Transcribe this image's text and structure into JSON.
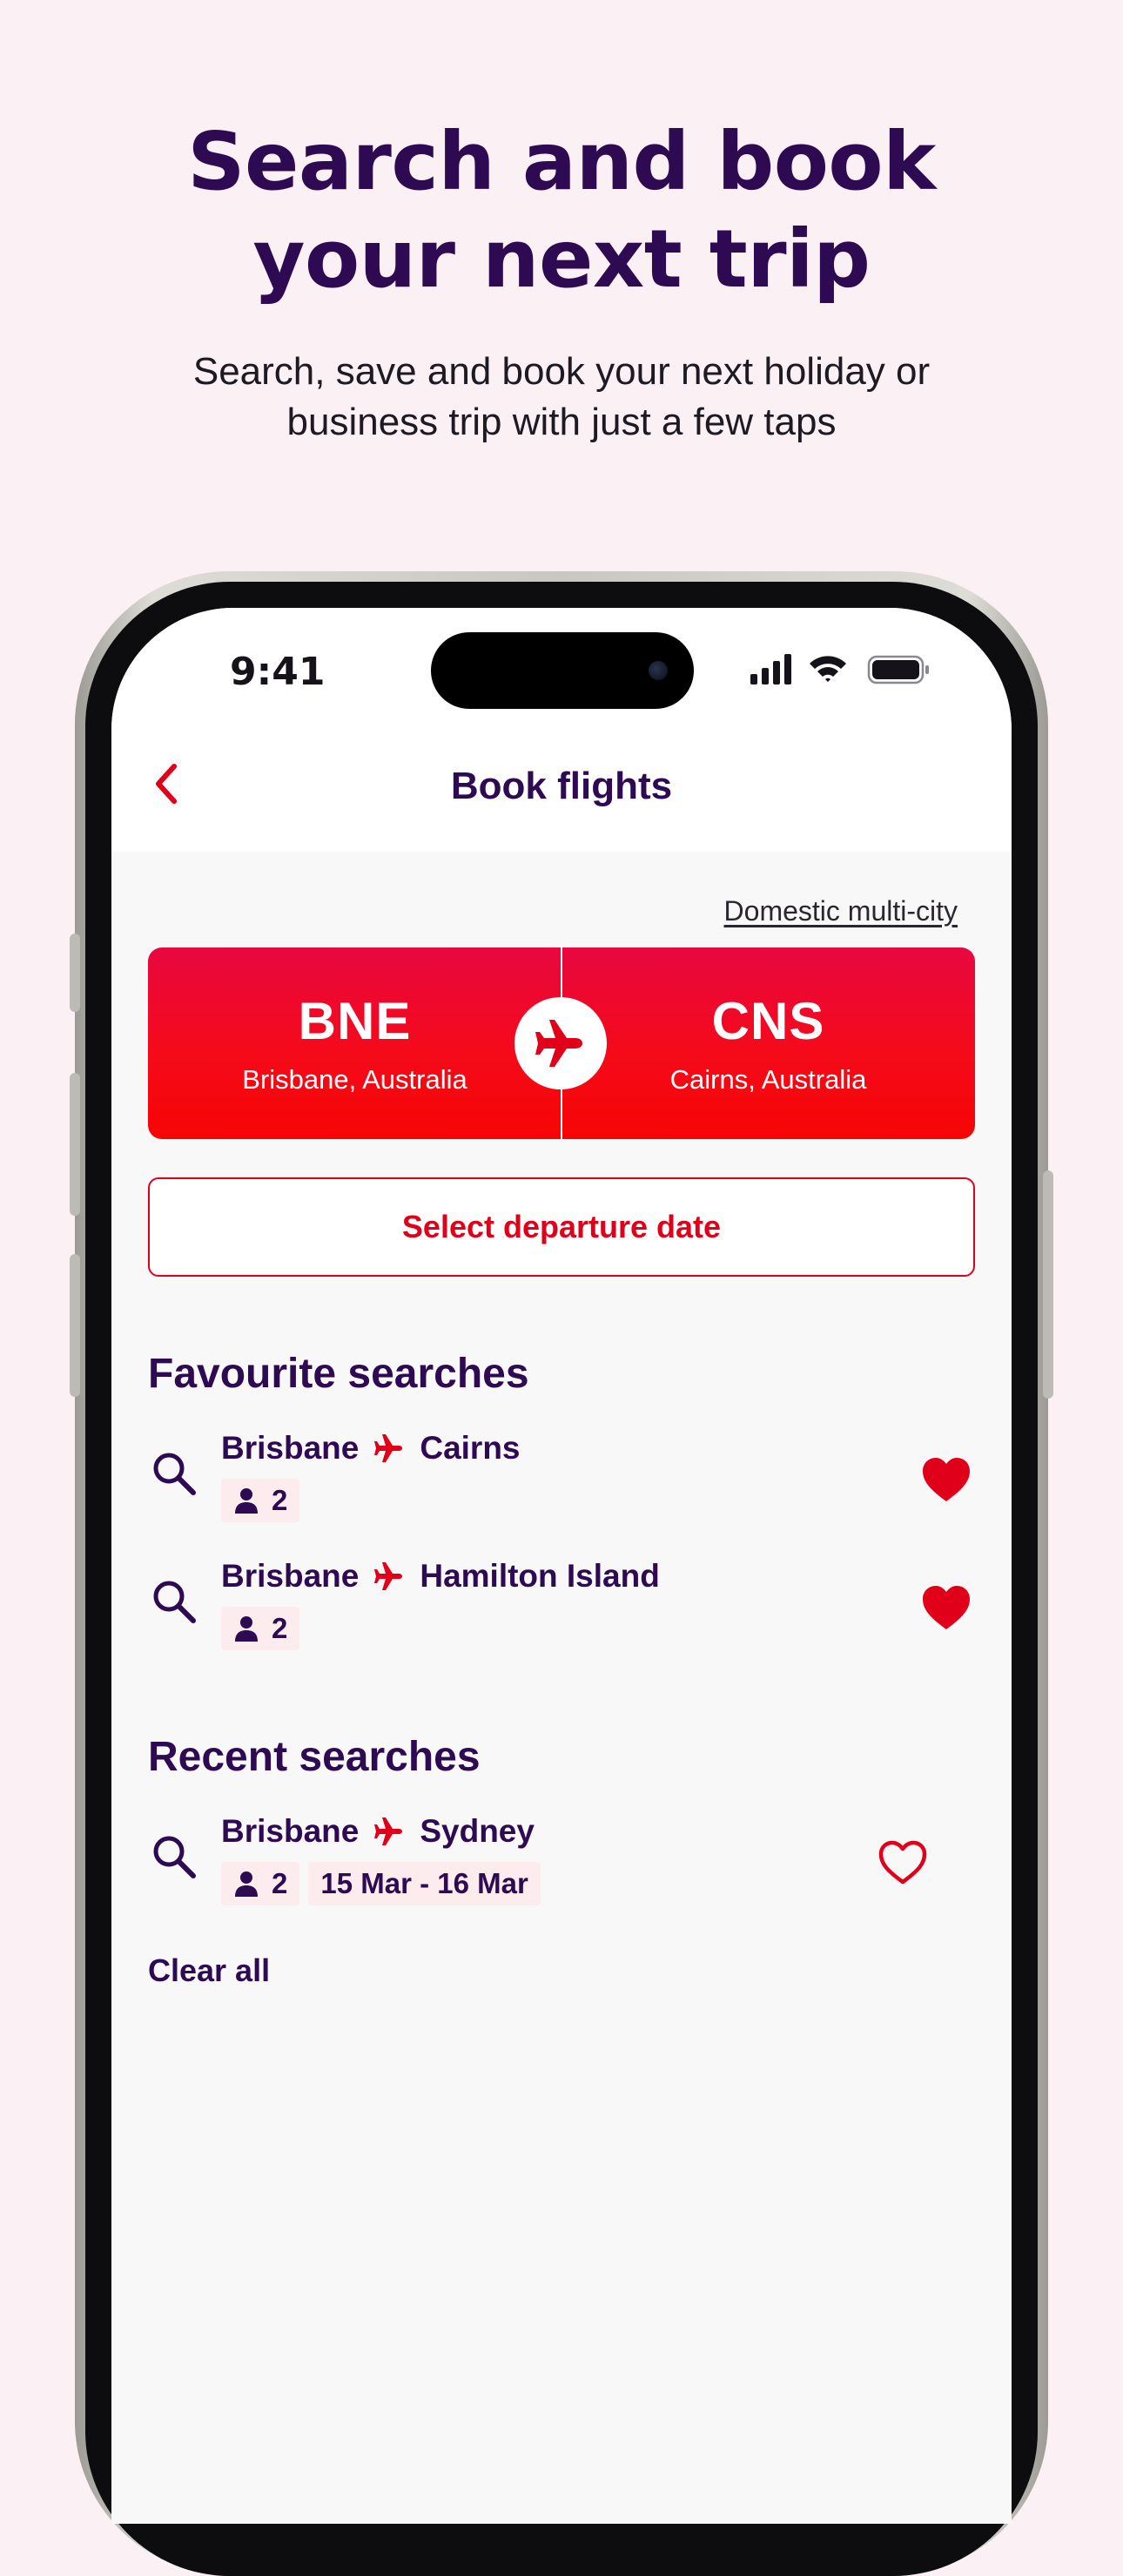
{
  "marketing": {
    "headline_line1": "Search and book",
    "headline_line2": "your next trip",
    "subhead_line1": "Search, save and book your next holiday or",
    "subhead_line2": "business trip with just a few taps"
  },
  "status_bar": {
    "time": "9:41"
  },
  "nav": {
    "title": "Book flights",
    "back_icon": "chevron-left-icon"
  },
  "booking": {
    "multi_city_link": "Domestic multi-city",
    "origin": {
      "code": "BNE",
      "city": "Brisbane, Australia"
    },
    "destination": {
      "code": "CNS",
      "city": "Cairns, Australia"
    },
    "swap_icon": "plane-icon",
    "date_button": "Select departure date"
  },
  "favourites": {
    "title": "Favourite searches",
    "items": [
      {
        "from": "Brisbane",
        "to": "Cairns",
        "passengers": "2",
        "favourited": true
      },
      {
        "from": "Brisbane",
        "to": "Hamilton Island",
        "passengers": "2",
        "favourited": true
      }
    ]
  },
  "recent": {
    "title": "Recent searches",
    "items": [
      {
        "from": "Brisbane",
        "to": "Sydney",
        "passengers": "2",
        "dates": "15 Mar - 16 Mar",
        "favourited": false
      }
    ],
    "clear_label": "Clear all"
  },
  "colors": {
    "brand_purple": "#2e0a52",
    "brand_red": "#e0001a",
    "background": "#fbf0f4"
  }
}
